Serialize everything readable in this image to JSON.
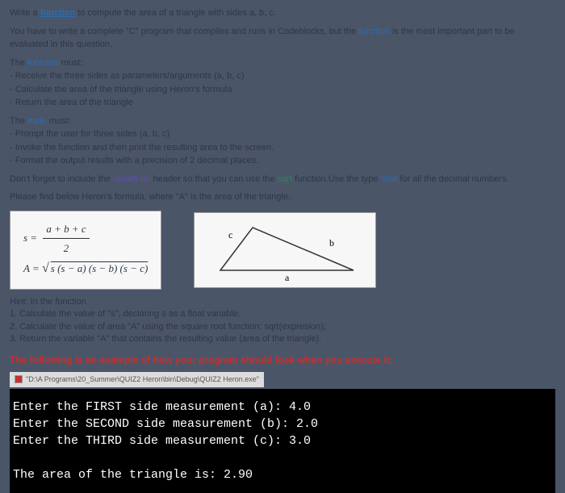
{
  "intro": {
    "prefix": "Write a ",
    "function_word": "function",
    "suffix": " to compute the area of a triangle with sides a, b, c."
  },
  "compile_line": {
    "p1": "You have to write a complete \"C\" program that compiles and runs in Codeblocks, but the ",
    "func": "function",
    "p2": " is the most important part to be evaluated in this question."
  },
  "func_section": {
    "head_p1": "The ",
    "head_func": "function",
    "head_p2": " must:",
    "items": [
      "Receive the three sides as parameters/arguments (a, b, c)",
      "Calculate the area of the triangle using Heron's formula",
      "Return the area of the triangle"
    ]
  },
  "main_section": {
    "head_p1": "The ",
    "head_main": "main",
    "head_p2": " must:",
    "items": [
      "Prompt the user for three sides (a, b, c)",
      "Invoke the function and then print the resulting area to the screen.",
      "Format the output results with a precision of 2 decimal places."
    ]
  },
  "math_line": {
    "p1": "Don't forget to include the ",
    "code": "<math.h>",
    "p2": " header so that you can use the ",
    "sqrt": "sqrt",
    "p3": " function.Use the type ",
    "float": "float",
    "p4": " for all the decimal numbers."
  },
  "heron_intro": {
    "p1": "Please find below Heron's formula, where ",
    "A": "\"A\"",
    "p2": " is the area of the triangle."
  },
  "formula": {
    "s_eq": "s = ",
    "s_num": "a + b + c",
    "s_den": "2",
    "A_eq": "A = ",
    "A_root": "s (s − a) (s − b) (s − c)"
  },
  "triangle": {
    "a": "a",
    "b": "b",
    "c": "c"
  },
  "hint": {
    "head": "Hint: In the function",
    "items": [
      "1. Calculate the value of \"s\", declaring s as a float variable.",
      "2. Calculate the value of area \"A\" using the square root function: sqrt(expresion);",
      "3. Return the variable \"A\" that contains the resulting value (area of the triangle)."
    ]
  },
  "example_header": "The following is an example of how your program should look when you execute it:",
  "terminal_path": "\"D:\\A Programs\\20_Summer\\QUIZ2 Heron\\bin\\Debug\\QUIZ2 Heron.exe\"",
  "terminal": {
    "l1": "Enter the FIRST side measurement (a): 4.0",
    "l2": "Enter the SECOND side measurement (b): 2.0",
    "l3": "Enter the THIRD side measurement (c): 3.0",
    "l4": "The area of the triangle is: 2.90"
  }
}
